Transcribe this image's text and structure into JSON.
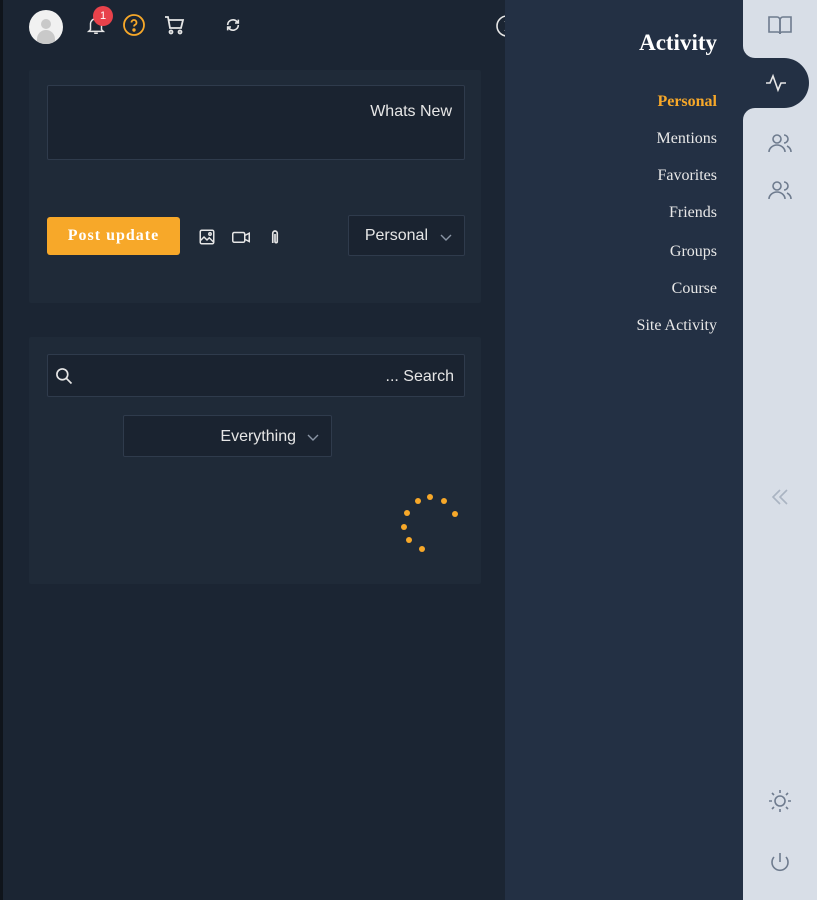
{
  "topbar": {
    "notification_count": "1",
    "icons": [
      "avatar",
      "bell-icon",
      "help-icon",
      "cart-icon",
      "refresh-icon",
      "chevron-right-circle-icon"
    ]
  },
  "composer": {
    "placeholder": "Whats New",
    "post_label": "Post update",
    "privacy_value": "Personal"
  },
  "feed": {
    "search_placeholder": "... Search",
    "filter_value": "Everything"
  },
  "subnav": {
    "title": "Activity",
    "items": [
      {
        "label": "Personal",
        "active": true
      },
      {
        "label": "Mentions",
        "active": false
      },
      {
        "label": "Favorites",
        "active": false
      },
      {
        "label": "Friends",
        "active": false
      },
      {
        "label": "Groups",
        "active": false
      },
      {
        "label": "Course",
        "active": false
      },
      {
        "label": "Site Activity",
        "active": false
      }
    ]
  },
  "rail": {
    "icons": [
      "book-icon",
      "activity-icon",
      "users-icon",
      "members-icon",
      "collapse-left-icon",
      "sun-icon",
      "power-icon"
    ]
  },
  "colors": {
    "accent": "#f7a829",
    "badge": "#e8424b",
    "main_bg": "#1b2533",
    "panel_bg": "#233044",
    "rail_bg": "#d8dee7"
  }
}
